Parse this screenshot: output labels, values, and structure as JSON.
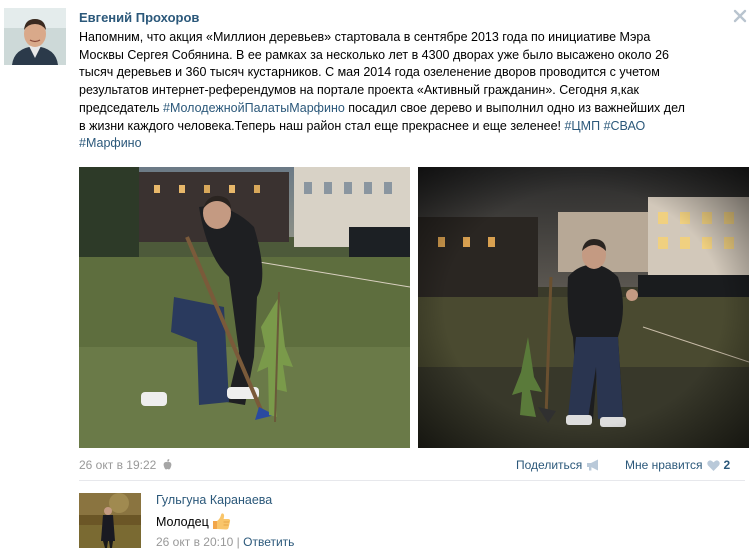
{
  "post": {
    "author": "Евгений Прохоров",
    "lines": [
      "Напомним, что акция «Миллион деревьев» стартовала в сентябре 2013 года по инициативе Мэра",
      "Москвы Сергея Собянина. В ее рамках за несколько лет в 4300 дворах уже было высажено около 26",
      "тысяч деревьев и 360 тысяч кустарников. С мая 2014 года озеленение дворов проводится с учетом",
      "результатов интернет-референдумов на портале проекта «Активный гражданин». Сегодня я,как"
    ],
    "line5_pre": "председатель ",
    "tag_palata": "#МолодежнойПалатыМарфино",
    "line5_post": " посадил свое дерево и выполнил одно из важнейших дел",
    "line6_pre": "в жизни каждого человека.Теперь наш район стал еще прекраснее и еще зеленее! ",
    "tag_cmp": "#ЦМП",
    "tag_svao": "#СВАО",
    "tag_marfino": "#Марфино",
    "date": "26 окт в 19:22",
    "share_label": "Поделиться",
    "like_label": "Мне нравится",
    "like_count": "2"
  },
  "comment": {
    "author": "Гульгуна Каранаева",
    "text": "Молодец",
    "date": "26 окт в 20:10",
    "separator": "|",
    "reply_label": "Ответить"
  },
  "icons": {
    "close": "close-icon",
    "apple": "apple-icon",
    "megaphone": "megaphone-icon",
    "heart": "heart-icon",
    "thumbs_up": "thumbs-up-emoji"
  },
  "colors": {
    "link": "#2b587a",
    "muted": "#999999",
    "divider": "#e7e8ec"
  }
}
